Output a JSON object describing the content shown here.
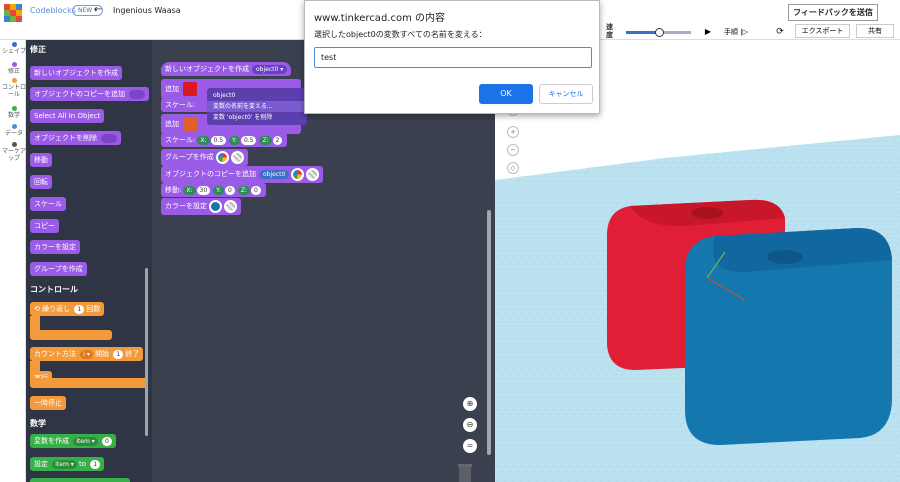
{
  "header": {
    "brand": "Codeblocks",
    "new_badge": "NEW",
    "project_name": "Ingenious Waasa",
    "feedback_label": "フィードバックを送信",
    "speed_label": "速度",
    "speed_level": 0.5,
    "step_label": "手順",
    "export_label": "エクスポート",
    "share_label": "共有"
  },
  "categories": [
    {
      "label": "シェイプ",
      "color": "#3a6ec8"
    },
    {
      "label": "修正",
      "color": "#9a5ce6"
    },
    {
      "label": "コントロール",
      "color": "#f39a3d"
    },
    {
      "label": "数学",
      "color": "#38b04a"
    },
    {
      "label": "データ",
      "color": "#4a90d9"
    },
    {
      "label": "マーケアップ",
      "color": "#555555"
    }
  ],
  "palette": {
    "section_modify": "修正",
    "modify_blocks": [
      "新しいオブジェクトを作成",
      "オブジェクトのコピーを追加",
      "Select All In Object",
      "オブジェクトを削除",
      "移動",
      "回転",
      "スケール",
      "コピー",
      "カラーを設定",
      "グループを作成"
    ],
    "section_control": "コントロール",
    "repeat_label": "繰り返し",
    "repeat_count": "1",
    "repeat_suffix": "回数",
    "count_label": "カウント方法",
    "count_var": "i",
    "count_start_label": "開始",
    "count_start": "1",
    "count_end_label": "終了",
    "do_label": "実行",
    "pause_label": "一時停止",
    "section_math": "数学",
    "create_var_label": "変数を作成",
    "create_var_name": "item",
    "create_var_value": "0",
    "set_label": "設定",
    "set_var_name": "item",
    "set_to": "to",
    "set_value": "1"
  },
  "workspace": {
    "create_obj_label": "新しいオブジェクトを作成",
    "create_obj_var": "object0",
    "add_label": "追加",
    "scale_label": "スケール:",
    "scale_x_label": "X:",
    "scale_x": "0.5",
    "scale_y_label": "Y:",
    "scale_y": "0.5",
    "scale_z_label": "Z:",
    "scale_z": "2",
    "group_label": "グループを作成",
    "copy_label": "オブジェクトのコピーを追加",
    "copy_var": "object0",
    "move_label": "移動:",
    "move_x_label": "X:",
    "move_x": "30",
    "move_y_label": "Y:",
    "move_y": "0",
    "move_z_label": "Z:",
    "move_z": "0",
    "color_label": "カラーを設定",
    "ctx_items": [
      "object0",
      "変数の名前を変える...",
      "変数 'object0' を削除"
    ]
  },
  "dialog": {
    "title": "www.tinkercad.com の内容",
    "message": "選択したobject0の変数すべての名前を変える：",
    "input_value": "test",
    "ok_label": "OK",
    "cancel_label": "キャンセル"
  },
  "colors": {
    "palette_bg": "#2f3544",
    "workspace_bg": "#3a404e",
    "modify": "#9a5ce6",
    "control": "#f39a3d",
    "math": "#38b04a",
    "grid_bg": "#bde3f0",
    "red_part": "#e01e35",
    "blue_part": "#1477ad"
  }
}
